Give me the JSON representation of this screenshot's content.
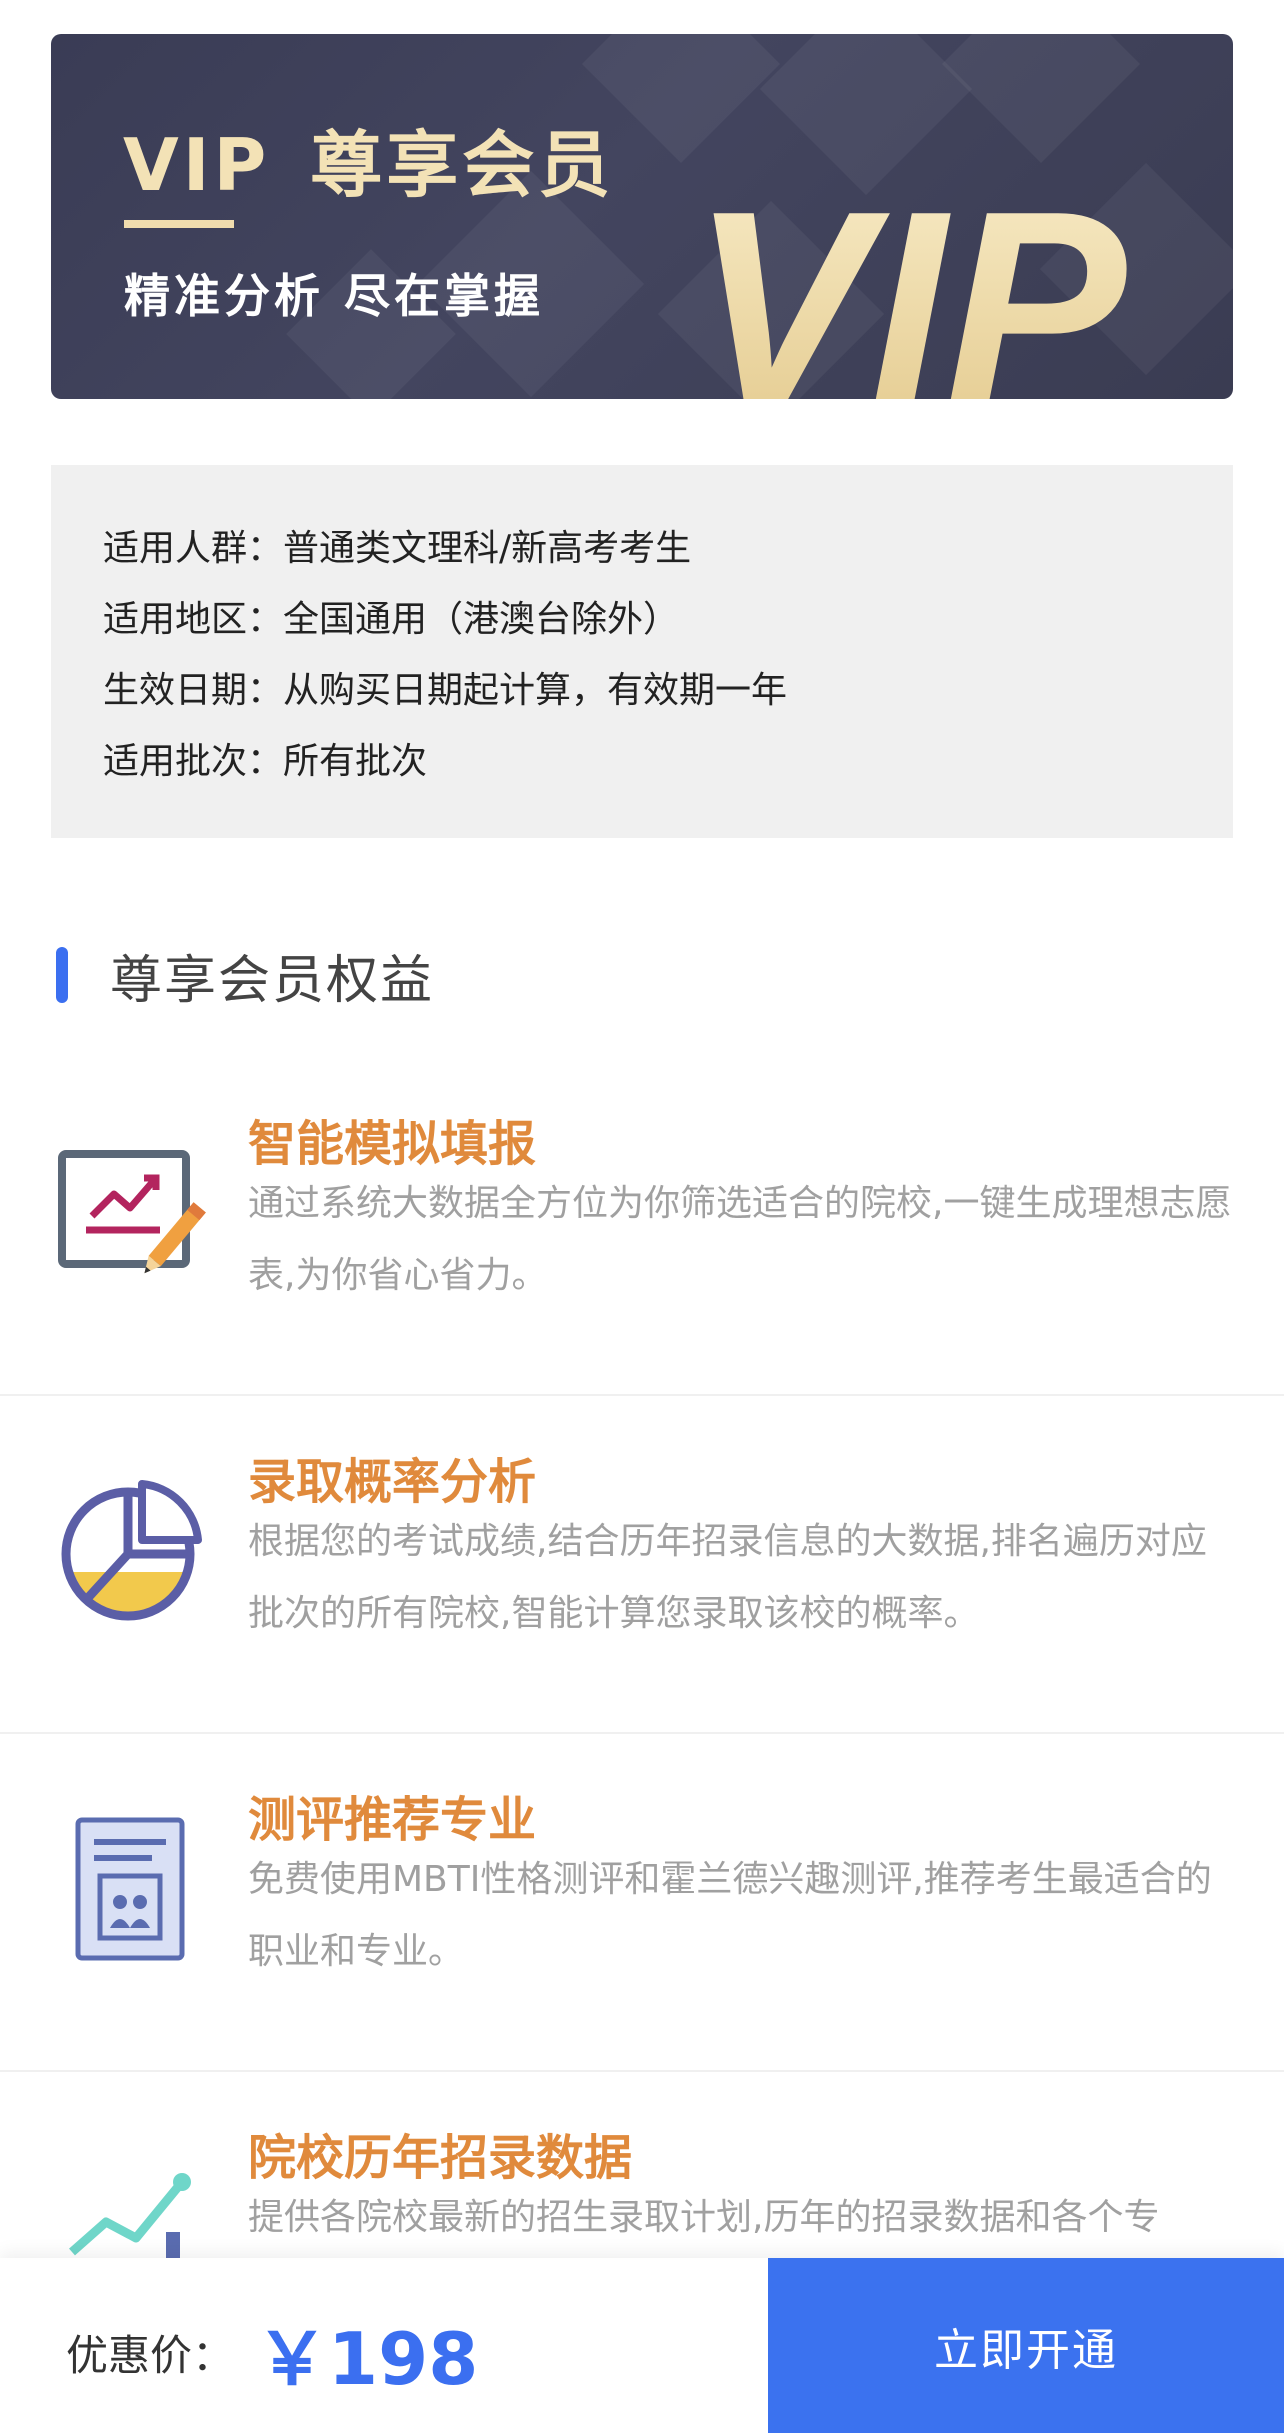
{
  "banner": {
    "title_prefix": "VIP",
    "title_main": "尊享会员",
    "subtitle": "精准分析 尽在掌握",
    "big_text": "VIP"
  },
  "info": {
    "rows": [
      "适用人群：普通类文理科/新高考考生",
      "适用地区：全国通用（港澳台除外）",
      "生效日期：从购买日期起计算，有效期一年",
      "适用批次：所有批次"
    ]
  },
  "section": {
    "title": "尊享会员权益"
  },
  "benefits": [
    {
      "title": "智能模拟填报",
      "desc": "通过系统大数据全方位为你筛选适合的院校,一键生成理想志愿表,为你省心省力。",
      "icon": "chart-edit-icon"
    },
    {
      "title": "录取概率分析",
      "desc": "根据您的考试成绩,结合历年招录信息的大数据,排名遍历对应批次的所有院校,智能计算您录取该校的概率。",
      "icon": "pie-chart-icon"
    },
    {
      "title": "测评推荐专业",
      "desc": "免费使用MBTI性格测评和霍兰德兴趣测评,推荐考生最适合的职业和专业。",
      "icon": "profile-document-icon"
    },
    {
      "title": "院校历年招录数据",
      "desc": "提供各院校最新的招生录取计划,历年的招录数据和各个专",
      "icon": "trend-chart-icon"
    }
  ],
  "footer": {
    "price_label": "优惠价：",
    "price": "￥198",
    "button": "立即开通"
  },
  "colors": {
    "accent_blue": "#3b6ff0",
    "orange_title": "#e08a3c",
    "banner_bg": "#3e405a",
    "gold": "#f3e2b6"
  }
}
